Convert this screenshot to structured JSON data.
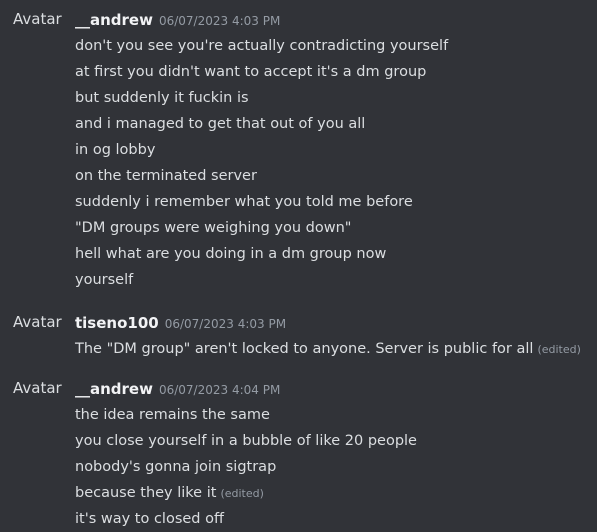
{
  "messages": [
    {
      "avatar_alt": "Avatar",
      "username": "__andrew",
      "timestamp": "06/07/2023 4:03 PM",
      "lines": [
        {
          "text": "don't you see you're actually contradicting yourself",
          "edited": ""
        },
        {
          "text": "at first you didn't want to accept it's a dm group",
          "edited": ""
        },
        {
          "text": "but suddenly it fuckin is",
          "edited": ""
        },
        {
          "text": "and i managed to get that out of you all",
          "edited": ""
        },
        {
          "text": "in og lobby",
          "edited": ""
        },
        {
          "text": "on the terminated server",
          "edited": ""
        },
        {
          "text": "suddenly i remember what you told me before",
          "edited": ""
        },
        {
          "text": "\"DM groups were weighing you down\"",
          "edited": ""
        },
        {
          "text": "hell what are you doing in a dm group now",
          "edited": ""
        },
        {
          "text": "yourself",
          "edited": ""
        }
      ]
    },
    {
      "avatar_alt": "Avatar",
      "username": "tiseno100",
      "timestamp": "06/07/2023 4:03 PM",
      "lines": [
        {
          "text": "The \"DM group\" aren't locked to anyone. Server is public for all",
          "edited": "(edited)"
        }
      ]
    },
    {
      "avatar_alt": "Avatar",
      "username": "__andrew",
      "timestamp": "06/07/2023 4:04 PM",
      "lines": [
        {
          "text": "the idea remains the same",
          "edited": ""
        },
        {
          "text": "you close yourself in a bubble of like 20 people",
          "edited": ""
        },
        {
          "text": "nobody's gonna join sigtrap",
          "edited": ""
        },
        {
          "text": "because they like it",
          "edited": "(edited)"
        },
        {
          "text": "it's way to closed off",
          "edited": ""
        }
      ]
    }
  ]
}
